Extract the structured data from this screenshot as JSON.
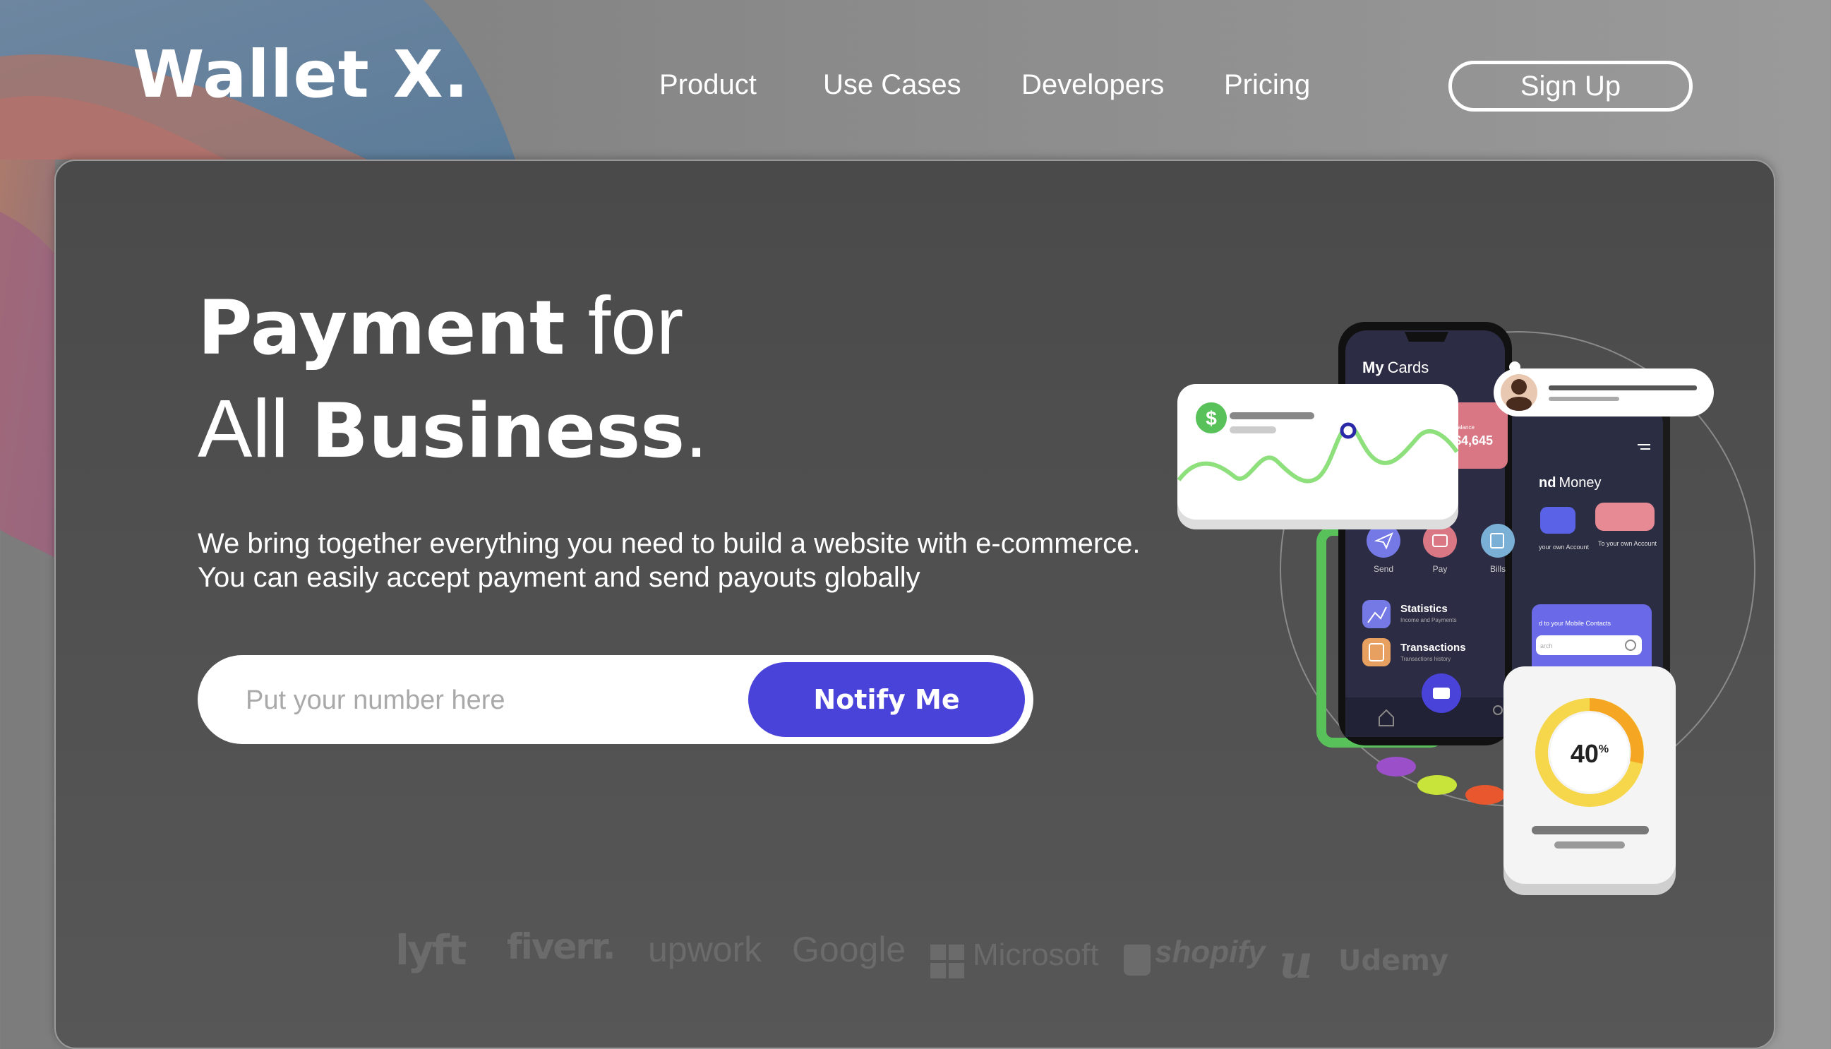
{
  "brand": {
    "logo": "Wallet X."
  },
  "nav": {
    "items": [
      {
        "label": "Product"
      },
      {
        "label": "Use Cases"
      },
      {
        "label": "Developers"
      },
      {
        "label": "Pricing"
      }
    ],
    "signup_label": "Sign Up"
  },
  "hero": {
    "headline_word1": "Payment",
    "headline_word2": " for",
    "headline_word3": "All ",
    "headline_word4": "Business",
    "headline_word5": ".",
    "subtitle": "We bring together everything you need to build a website with e-commerce. You can easily accept payment and send payouts globally",
    "input_placeholder": "Put your number here",
    "input_value": "",
    "cta_label": "Notify Me"
  },
  "illustration": {
    "phone_title_bold": "My",
    "phone_title": "Cards",
    "balance_label": "Balance",
    "balance_value": "$4,645",
    "action_send": "Send",
    "action_pay": "Pay",
    "action_bills": "Bills",
    "stat_title": "Statistics",
    "stat_sub": "Income and Payments",
    "tx_title": "Transactions",
    "tx_sub": "Transactions history",
    "phone2_title_bold": "nd",
    "phone2_title": "Money",
    "phone2_own": "your own Account",
    "phone2_to_own": "To your own Account",
    "phone2_contacts": "d to your Mobile Contacts",
    "phone2_search": "arch",
    "percent_value": "40",
    "percent_unit": "%",
    "dollar_icon": "$"
  },
  "partners": [
    "lyft",
    "fiverr.",
    "upwork",
    "Google",
    "Microsoft",
    "shopify",
    "Udemy"
  ],
  "colors": {
    "accent": "#4a43d9",
    "card_bg": "#4e4e4e",
    "green": "#58c15a",
    "blue": "#3a57e0",
    "orange": "#f5a623"
  }
}
